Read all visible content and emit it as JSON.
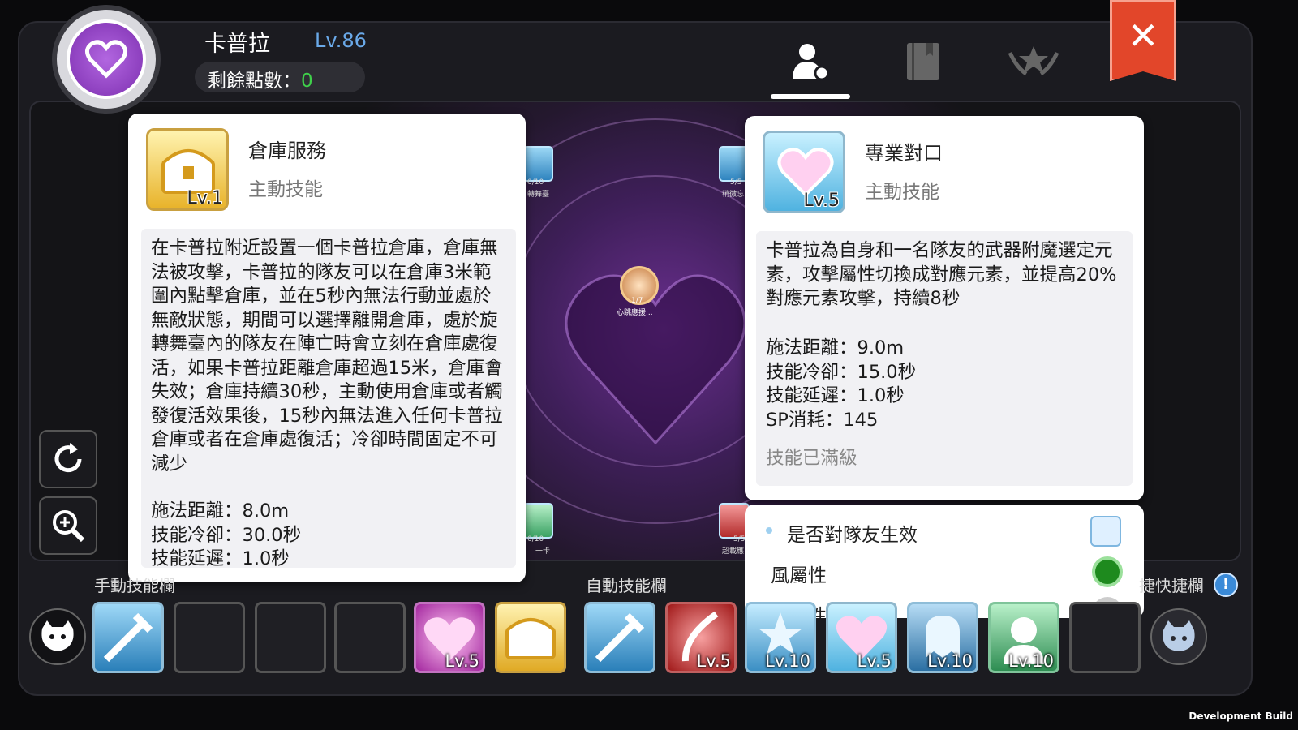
{
  "character": {
    "name": "卡普拉",
    "level": "Lv.86",
    "points_label": "剩餘點數：",
    "points_value": "0"
  },
  "tabs": [
    {
      "icon": "person-skill-icon"
    },
    {
      "icon": "book-icon"
    },
    {
      "icon": "emblem-star-icon"
    }
  ],
  "close_label": "✕",
  "center_node": {
    "count": "1/7",
    "label": "心跳應援..."
  },
  "board_nodes": [
    {
      "count": "0/10",
      "label": "轉舞臺"
    },
    {
      "count": "5/5",
      "label": "稍微忘"
    },
    {
      "count": "0/10",
      "label": "一卡"
    },
    {
      "count": "5/5",
      "label": "超載應"
    }
  ],
  "left_card": {
    "title": "倉庫服務",
    "type": "主動技能",
    "icon_level": "Lv.1",
    "description": "在卡普拉附近設置一個卡普拉倉庫，倉庫無法被攻擊，卡普拉的隊友可以在倉庫3米範圍內點擊倉庫，並在5秒內無法行動並處於無敵狀態，期間可以選擇離開倉庫，處於旋轉舞臺內的隊友在陣亡時會立刻在倉庫處復活，如果卡普拉距離倉庫超過15米，倉庫會失效；倉庫持續30秒，主動使用倉庫或者觸發復活效果後，15秒內無法進入任何卡普拉倉庫或者在倉庫處復活；冷卻時間固定不可減少",
    "stats": [
      "施法距離：8.0m",
      "技能冷卻：30.0秒",
      "技能延遲：1.0秒"
    ]
  },
  "right_card": {
    "title": "專業對口",
    "type": "主動技能",
    "icon_level": "Lv.5",
    "description": "卡普拉為自身和一名隊友的武器附魔選定元素，攻擊屬性切換成對應元素，並提高20%對應元素攻擊，持續8秒",
    "stats": [
      "施法距離：9.0m",
      "技能冷卻：15.0秒",
      "技能延遲：1.0秒",
      "SP消耗：145"
    ],
    "footer": "技能已滿級"
  },
  "options": [
    {
      "label": "是否對隊友生效",
      "control": "checkbox",
      "checked": false
    },
    {
      "label": "風屬性",
      "control": "radio",
      "checked": true
    },
    {
      "label": "地屬性",
      "control": "radio",
      "checked": false
    }
  ],
  "manual_bar": {
    "label": "手動技能欄",
    "slots": [
      "",
      "",
      "",
      "",
      "Lv.5",
      ""
    ]
  },
  "auto_bar": {
    "label": "自動技能欄",
    "slots": [
      "",
      "Lv.5",
      "Lv.10",
      "Lv.5",
      "Lv.10",
      "Lv.10",
      ""
    ]
  },
  "quick_bar_label": "捷快捷欄",
  "dev_build": "Development Build",
  "colors": {
    "accent_purple": "#8a3cc2",
    "close_red": "#e2462a",
    "level_blue": "#6aa9e8",
    "points_green": "#3fd04a"
  }
}
